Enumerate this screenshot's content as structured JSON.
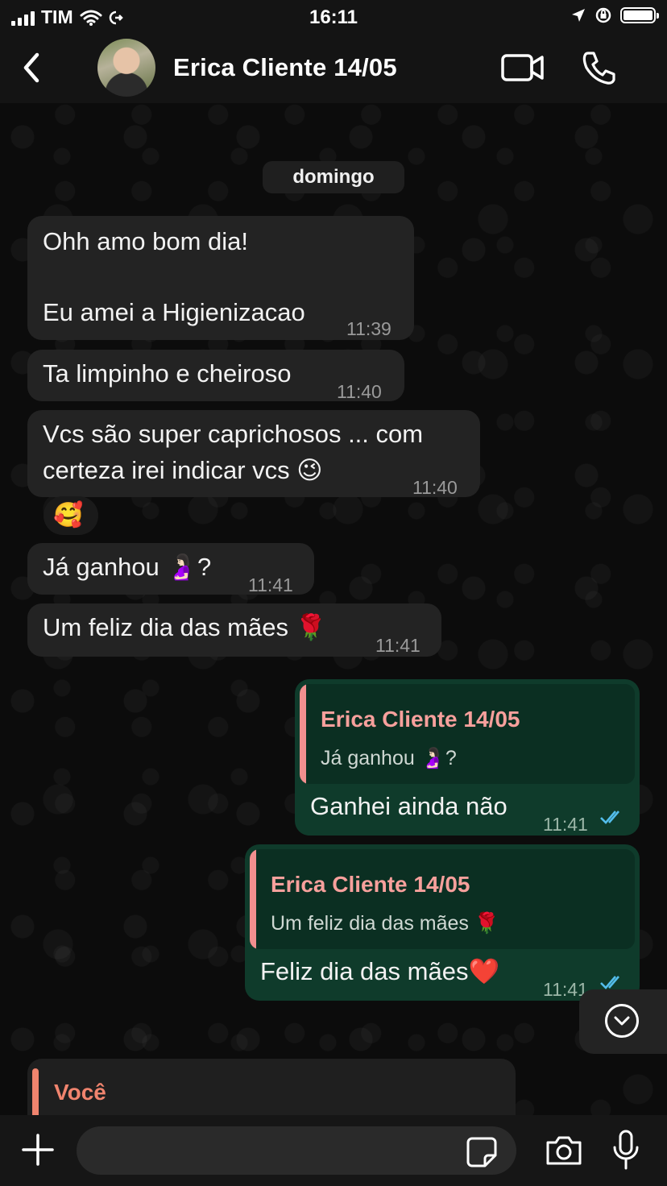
{
  "status_bar": {
    "carrier": "TIM",
    "time": "16:11"
  },
  "header": {
    "contact_name": "Erica Cliente 14/05"
  },
  "date_separator": "domingo",
  "messages": [
    {
      "line1": "Ohh amo bom dia!",
      "line2": "Eu amei a Higienizacao",
      "time": "11:39"
    },
    {
      "text": "Ta limpinho e cheiroso",
      "time": "11:40"
    },
    {
      "line1": "Vcs são super caprichosos ... com",
      "line2": "certeza irei indicar vcs 😉",
      "time": "11:40"
    },
    {
      "text": "🥰"
    },
    {
      "text": "Já ganhou 🤰🏻?",
      "time": "11:41"
    },
    {
      "text": "Um feliz dia das mães 🌹",
      "time": "11:41"
    },
    {
      "quote_name": "Erica Cliente 14/05",
      "quote_text": "Já ganhou 🤰🏻?",
      "text": "Ganhei ainda não",
      "time": "11:41"
    },
    {
      "quote_name": "Erica Cliente 14/05",
      "quote_text": "Um feliz dia das mães 🌹",
      "text": "Feliz dia das mães❤️",
      "time": "11:41"
    }
  ],
  "reply_preview": {
    "name": "Você"
  },
  "input": {
    "placeholder": ""
  },
  "colors": {
    "outgoing": "#0f3b2b",
    "incoming": "#232323",
    "quote_name": "#f7a09c",
    "reply_accent": "#f0846e",
    "read_ticks": "#53bdeb"
  },
  "icons": [
    "back-arrow-icon",
    "video-call-icon",
    "phone-icon",
    "chevron-down-icon",
    "plus-icon",
    "sticker-icon",
    "camera-icon",
    "microphone-icon",
    "double-check-icon"
  ]
}
